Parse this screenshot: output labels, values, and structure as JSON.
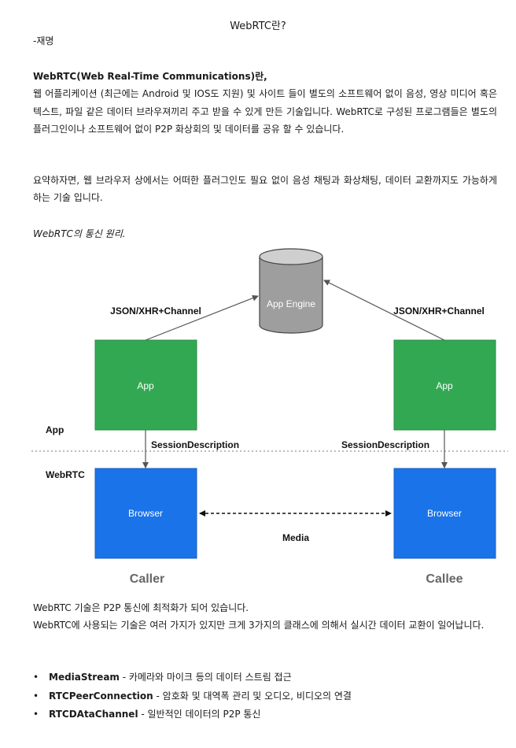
{
  "doc": {
    "title": "WebRTC란?",
    "author": "-재명",
    "intro_term": "WebRTC(Web Real-Time Communications)란,",
    "intro_text": "웹 어플리케이션 (최근에는 Android 및 IOS도 지원) 및 사이트 들이 별도의 소프트웨어 없이 음성, 영상 미디어 혹은 텍스트, 파일 같은 데이터 브라우져끼리 주고 받을 수 있게 만든 기술입니다. WebRTC로 구성된 프로그램들은 별도의 플러그인이나 소프트웨어 없이 P2P 화상회의 및 데이터를 공유 할 수 있습니다.",
    "summary": "요약하자면, 웹 브라우저 상에서는 어떠한 플러그인도 필요 없이 음성 채팅과 화상채팅, 데이터 교환까지도 가능하게 하는 기술 입니다.",
    "diagram_caption": "WebRTC의 통신 원리.",
    "closing_1": "WebRTC 기술은 P2P 통신에 최적화가 되어 있습니다.",
    "closing_2": "WebRTC에 사용되는 기술은 여러 가지가 있지만 크게 3가지의 클래스에 의해서 실시간 데이터 교환이 일어납니다.",
    "bullets": [
      {
        "term": "MediaStream",
        "desc": " - 카메라와 마이크 등의 데이터 스트림 접근"
      },
      {
        "term": "RTCPeerConnection",
        "desc": " - 암호화 및 대역폭 관리 및 오디오, 비디오의 연결"
      },
      {
        "term": "RTCDAtaChannel",
        "desc": " - 일반적인 데이터의 P2P 통신"
      }
    ]
  },
  "diagram": {
    "server": "App Engine",
    "link_left": "JSON/XHR+Channel",
    "link_right": "JSON/XHR+Channel",
    "app_left": "App",
    "app_right": "App",
    "layer_app": "App",
    "layer_webrtc": "WebRTC",
    "session_left": "SessionDescription",
    "session_right": "SessionDescription",
    "browser_left": "Browser",
    "browser_right": "Browser",
    "media": "Media",
    "caller": "Caller",
    "callee": "Callee",
    "colors": {
      "app_green": "#33a853",
      "browser_blue": "#1a73e8",
      "db_gray": "#9e9e9e"
    }
  }
}
